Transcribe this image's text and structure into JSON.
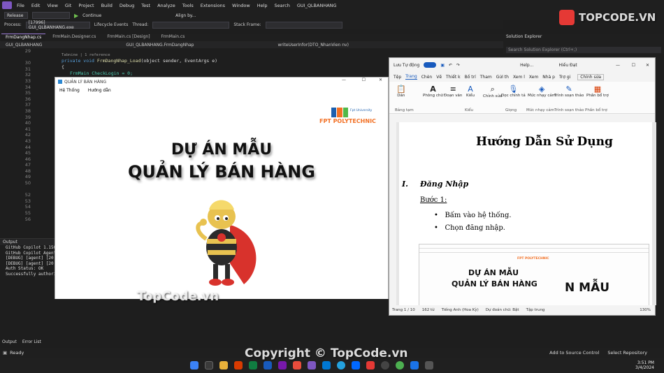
{
  "vs": {
    "menu": [
      "File",
      "Edit",
      "View",
      "Git",
      "Project",
      "Build",
      "Debug",
      "Test",
      "Analyze",
      "Tools",
      "Extensions",
      "Window",
      "Help"
    ],
    "search": "Search",
    "solution_name": "GUI_QLBANHANG",
    "config": "Release",
    "continue_label": "Continue",
    "align_label": "Align by...",
    "process_label": "Process:",
    "process_value": "[17996] GUI_QLBANHANG.exe",
    "lifecycle": "Lifecycle Events",
    "thread_label": "Thread:",
    "stack_label": "Stack Frame:",
    "tabs": [
      "FrmDangNhap.cs",
      "FrmMain.Designer.cs",
      "FrmMain.cs [Design]",
      "FrmMain.cs"
    ],
    "nav_project": "GUI_QLBANHANG",
    "nav_class": "GUI_QLBANHANG.FrmDangNhap",
    "nav_method": "writeUserInfor(DTO_NhanVien nv)",
    "line_numbers": [
      "29",
      "",
      "30",
      "31",
      "32",
      "33",
      "34",
      "35",
      "36",
      "37",
      "38",
      "39",
      "40",
      "41",
      "42",
      "43",
      "44",
      "45",
      "46",
      "47",
      "48",
      "49",
      "50",
      "",
      "52",
      "53",
      "54",
      "55",
      "56"
    ],
    "code_ref": "Tabnine | 1 reference",
    "code_line1_kw": "private void",
    "code_line1_name": "FrmDangNhap_Load",
    "code_line1_args": "(object sender, EventArgs e)",
    "code_line2": "{",
    "code_line3": "FrmMain CheckLogin = 0;",
    "output_title": "Output",
    "output_lines": [
      "GitHub Copilot 1.150",
      "GitHub Copilot Agent",
      "[DEBUG] [agent] [20",
      "[DEBUG] [agent] [20",
      "Auth Status: OK",
      "Successfully authori"
    ],
    "bottom_tabs": [
      "Output",
      "Error List"
    ],
    "status_ready": "Ready",
    "status_source": "Add to Source Control",
    "status_repo": "Select Repository",
    "solution_explorer": "Solution Explorer",
    "solution_search": "Search Solution Explorer (Ctrl+;)"
  },
  "app": {
    "title": "QUẢN LÝ BÁN HÀNG",
    "menu": [
      "Hệ Thống",
      "Hướng dẫn"
    ],
    "logo_sub": "Fpt University",
    "logo_text": "FPT POLYTECHNIC",
    "heading1": "DỰ ÁN MẪU",
    "heading2": "QUẢN LÝ BÁN HÀNG"
  },
  "word": {
    "autosave": "Lưu Tự động",
    "doc_title": "Help...",
    "user": "Hiếu Đạt",
    "user_initials": "ĐH",
    "tabs": [
      "Tệp",
      "Trang",
      "Chèn",
      "Vẽ",
      "Thiết k",
      "Bố trí",
      "Tham",
      "Gửi th",
      "Xem l",
      "Xem",
      "Nhà p",
      "Trợ gi"
    ],
    "edit_mode": "Chính sửa",
    "ribbon": {
      "paste": "Dán",
      "font": "Phông chữ",
      "paragraph": "Đoạn văn",
      "styles": "Kiểu",
      "editing": "Chỉnh sửa",
      "dictate": "Đọc chính tả",
      "sensitivity": "Mức nhạy cảm",
      "editor": "Trình soạn thảo",
      "addins": "Phần bổ trợ"
    },
    "groups": [
      "Bảng tạm",
      "Kiểu",
      "Giọng",
      "Mức nhạy cảm",
      "Trình soạn thảo",
      "Phần bổ trợ"
    ],
    "doc_heading": "Hướng Dẫn Sử Dụng",
    "section_num": "I.",
    "section_title": "Đăng Nhập",
    "step": "Bước 1:",
    "bullets": [
      "Bấm vào hệ thống.",
      "Chọn đăng nhập."
    ],
    "thumb_heading1": "DỰ ÁN MẪU",
    "thumb_heading2": "QUẢN LÝ BÁN HÀNG",
    "thumb_overflow": "N MẪU",
    "status_page": "Trang 1 / 10",
    "status_words": "162 từ",
    "status_lang": "Tiếng Anh (Hoa Kỳ)",
    "status_predict": "Dự đoán chữ: Bật",
    "status_focus": "Tập trung",
    "status_zoom": "130%"
  },
  "watermarks": {
    "brand": "TOPCODE.VN",
    "center": "TopCode.vn",
    "bottom": "Copyright © TopCode.vn"
  },
  "taskbar": {
    "time": "3:51 PM",
    "date": "3/4/2024"
  }
}
